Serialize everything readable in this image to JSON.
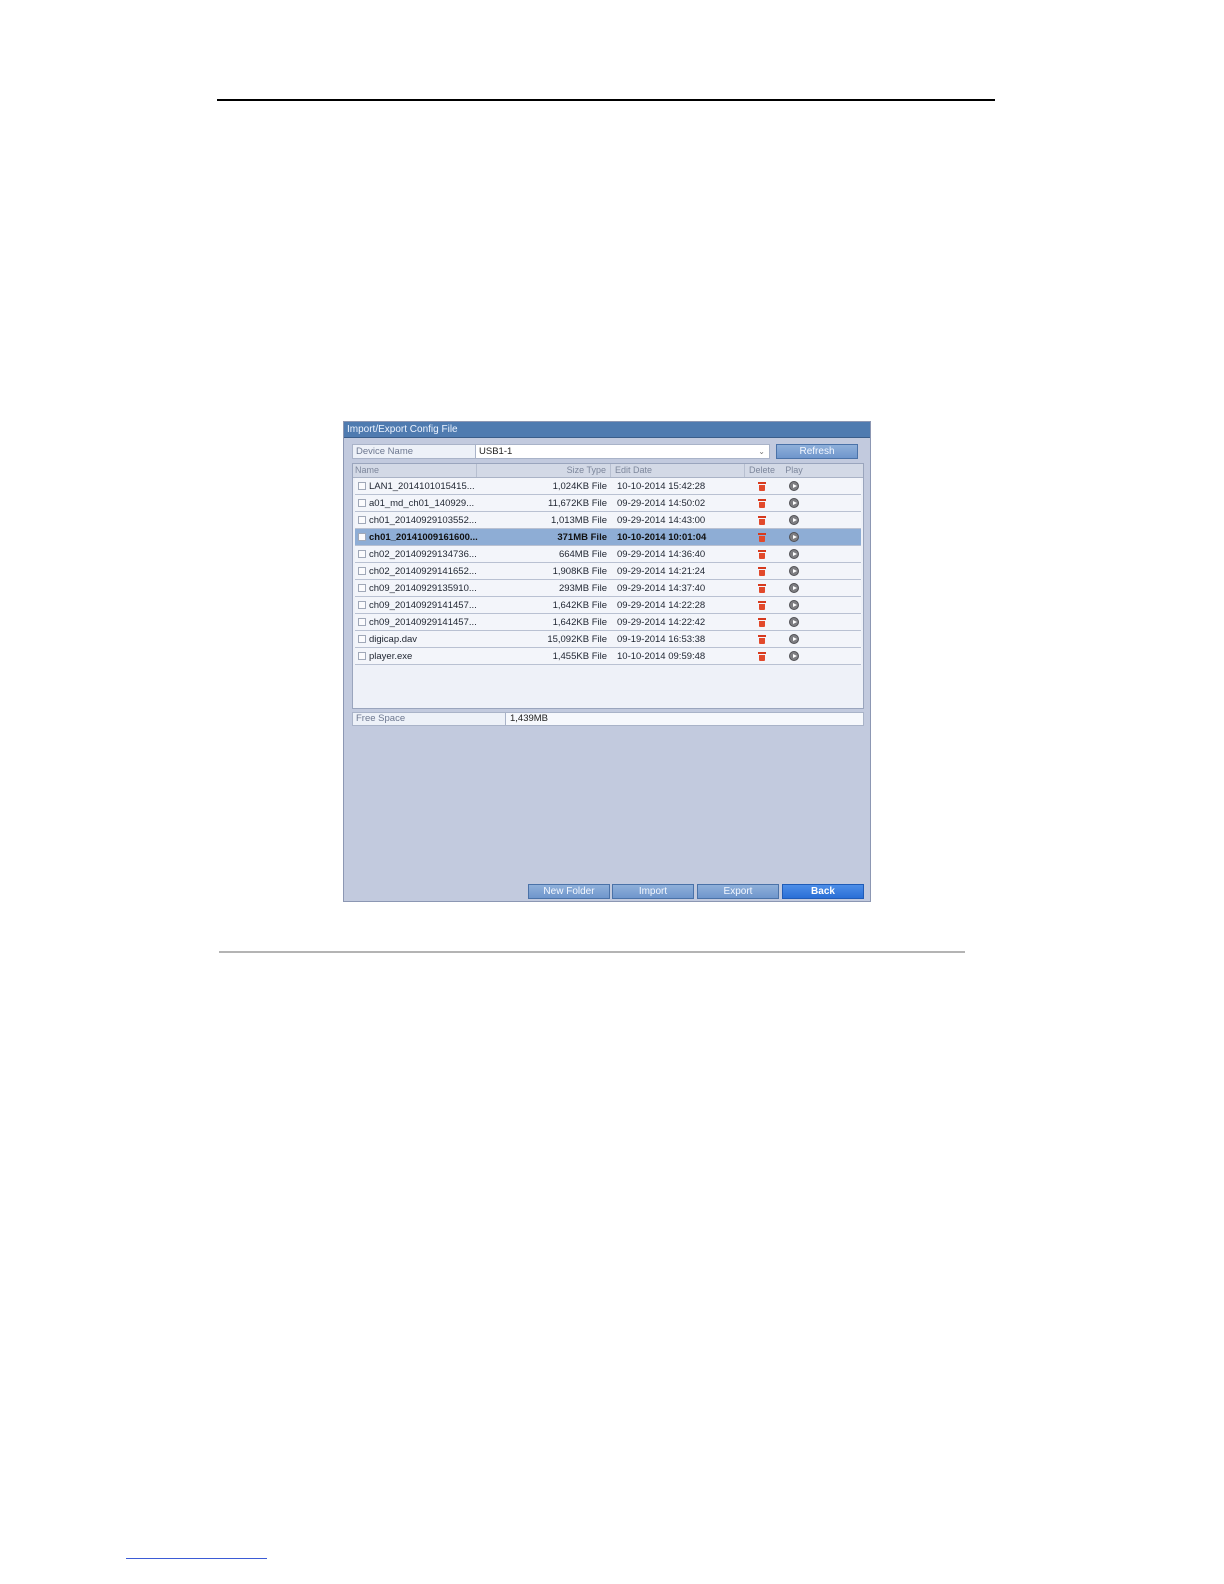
{
  "window": {
    "title": "Import/Export Config File"
  },
  "device": {
    "label": "Device Name",
    "value": "USB1-1",
    "refresh_label": "Refresh"
  },
  "table": {
    "columns": {
      "name": "Name",
      "size_type": "Size Type",
      "edit_date": "Edit Date",
      "delete": "Delete",
      "play": "Play"
    },
    "rows": [
      {
        "name": "LAN1_2014101015415...",
        "size": "1,024KB",
        "type": "File",
        "date": "10-10-2014 15:42:28",
        "selected": false
      },
      {
        "name": "a01_md_ch01_140929...",
        "size": "11,672KB",
        "type": "File",
        "date": "09-29-2014 14:50:02",
        "selected": false
      },
      {
        "name": "ch01_20140929103552...",
        "size": "1,013MB",
        "type": "File",
        "date": "09-29-2014 14:43:00",
        "selected": false
      },
      {
        "name": "ch01_20141009161600...",
        "size": "371MB",
        "type": "File",
        "date": "10-10-2014 10:01:04",
        "selected": true
      },
      {
        "name": "ch02_20140929134736...",
        "size": "664MB",
        "type": "File",
        "date": "09-29-2014 14:36:40",
        "selected": false
      },
      {
        "name": "ch02_20140929141652...",
        "size": "1,908KB",
        "type": "File",
        "date": "09-29-2014 14:21:24",
        "selected": false
      },
      {
        "name": "ch09_20140929135910...",
        "size": "293MB",
        "type": "File",
        "date": "09-29-2014 14:37:40",
        "selected": false
      },
      {
        "name": "ch09_20140929141457...",
        "size": "1,642KB",
        "type": "File",
        "date": "09-29-2014 14:22:28",
        "selected": false
      },
      {
        "name": "ch09_20140929141457...",
        "size": "1,642KB",
        "type": "File",
        "date": "09-29-2014 14:22:42",
        "selected": false
      },
      {
        "name": "digicap.dav",
        "size": "15,092KB",
        "type": "File",
        "date": "09-19-2014 16:53:38",
        "selected": false
      },
      {
        "name": "player.exe",
        "size": "1,455KB",
        "type": "File",
        "date": "10-10-2014 09:59:48",
        "selected": false
      }
    ]
  },
  "free_space": {
    "label": "Free Space",
    "value": "1,439MB"
  },
  "buttons": {
    "new_folder": "New Folder",
    "import": "Import",
    "export": "Export",
    "back": "Back"
  },
  "icons": {
    "file": "file-icon",
    "delete": "trash-icon",
    "play": "play-icon"
  }
}
